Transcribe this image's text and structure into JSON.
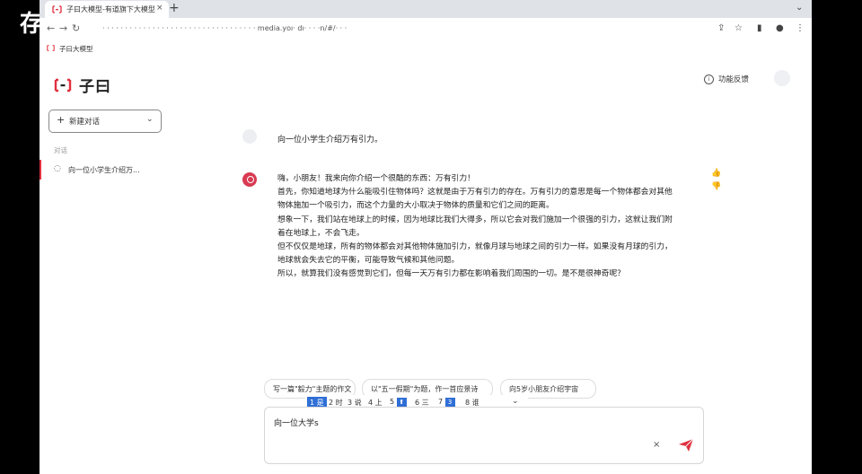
{
  "watermark": {
    "glyph": "存"
  },
  "browser": {
    "tab_title": "子曰大模型-有道旗下大模型",
    "tab_close": "×",
    "new_tab": "+",
    "tab_menu": "⌄",
    "url": "· · · · · · ·  · · · · · · · · · · · · · · · · · · · · ·  · · · · · · media.yoı· dı· · · ·n/#/· · ·",
    "bookmark_label": "子曰大模型"
  },
  "app": {
    "logo_text": "子曰",
    "new_chat_label": "新建对话",
    "section_label": "对话",
    "conversation_title": "向一位小学生介绍万...",
    "feedback_label": "功能反馈",
    "user_message": "向一位小学生介绍万有引力。",
    "bot_paragraphs": [
      "嗨，小朋友！我来向你介绍一个很酷的东西：万有引力！",
      "首先，你知道地球为什么能吸引住物体吗？这就是由于万有引力的存在。万有引力的意思是每一个物体都会对其他物体施加一个吸引力，而这个力量的大小取决于物体的质量和它们之间的距离。",
      "想象一下，我们站在地球上的时候，因为地球比我们大得多，所以它会对我们施加一个很强的引力，这就让我们附着在地球上，不会飞走。",
      "但不仅仅是地球，所有的物体都会对其他物体施加引力，就像月球与地球之间的引力一样。如果没有月球的引力，地球就会失去它的平衡，可能导致气候和其他问题。",
      "所以，就算我们没有感觉到它们，但每一天万有引力都在影响着我们周围的一切。是不是很神奇呢？"
    ],
    "suggestions": [
      "写一篇\"毅力\"主题的作文",
      "以\"五一假期\"为题，作一首应景诗",
      "向5岁小朋友介绍宇宙"
    ],
    "ime": {
      "c1": "1 是",
      "c2": "2 时",
      "c3": "3 说",
      "c4": "4 上",
      "c5": "5",
      "c5b": "6 三",
      "c6": "7",
      "c7": "8 谁",
      "k1": "⬆",
      "k2": "3"
    },
    "input_value": "向一位大学s",
    "clear": "×"
  },
  "colors": {
    "brand": "#e0303f",
    "bot_avatar": "#d83a52",
    "ime_select": "#2f6fd6"
  }
}
